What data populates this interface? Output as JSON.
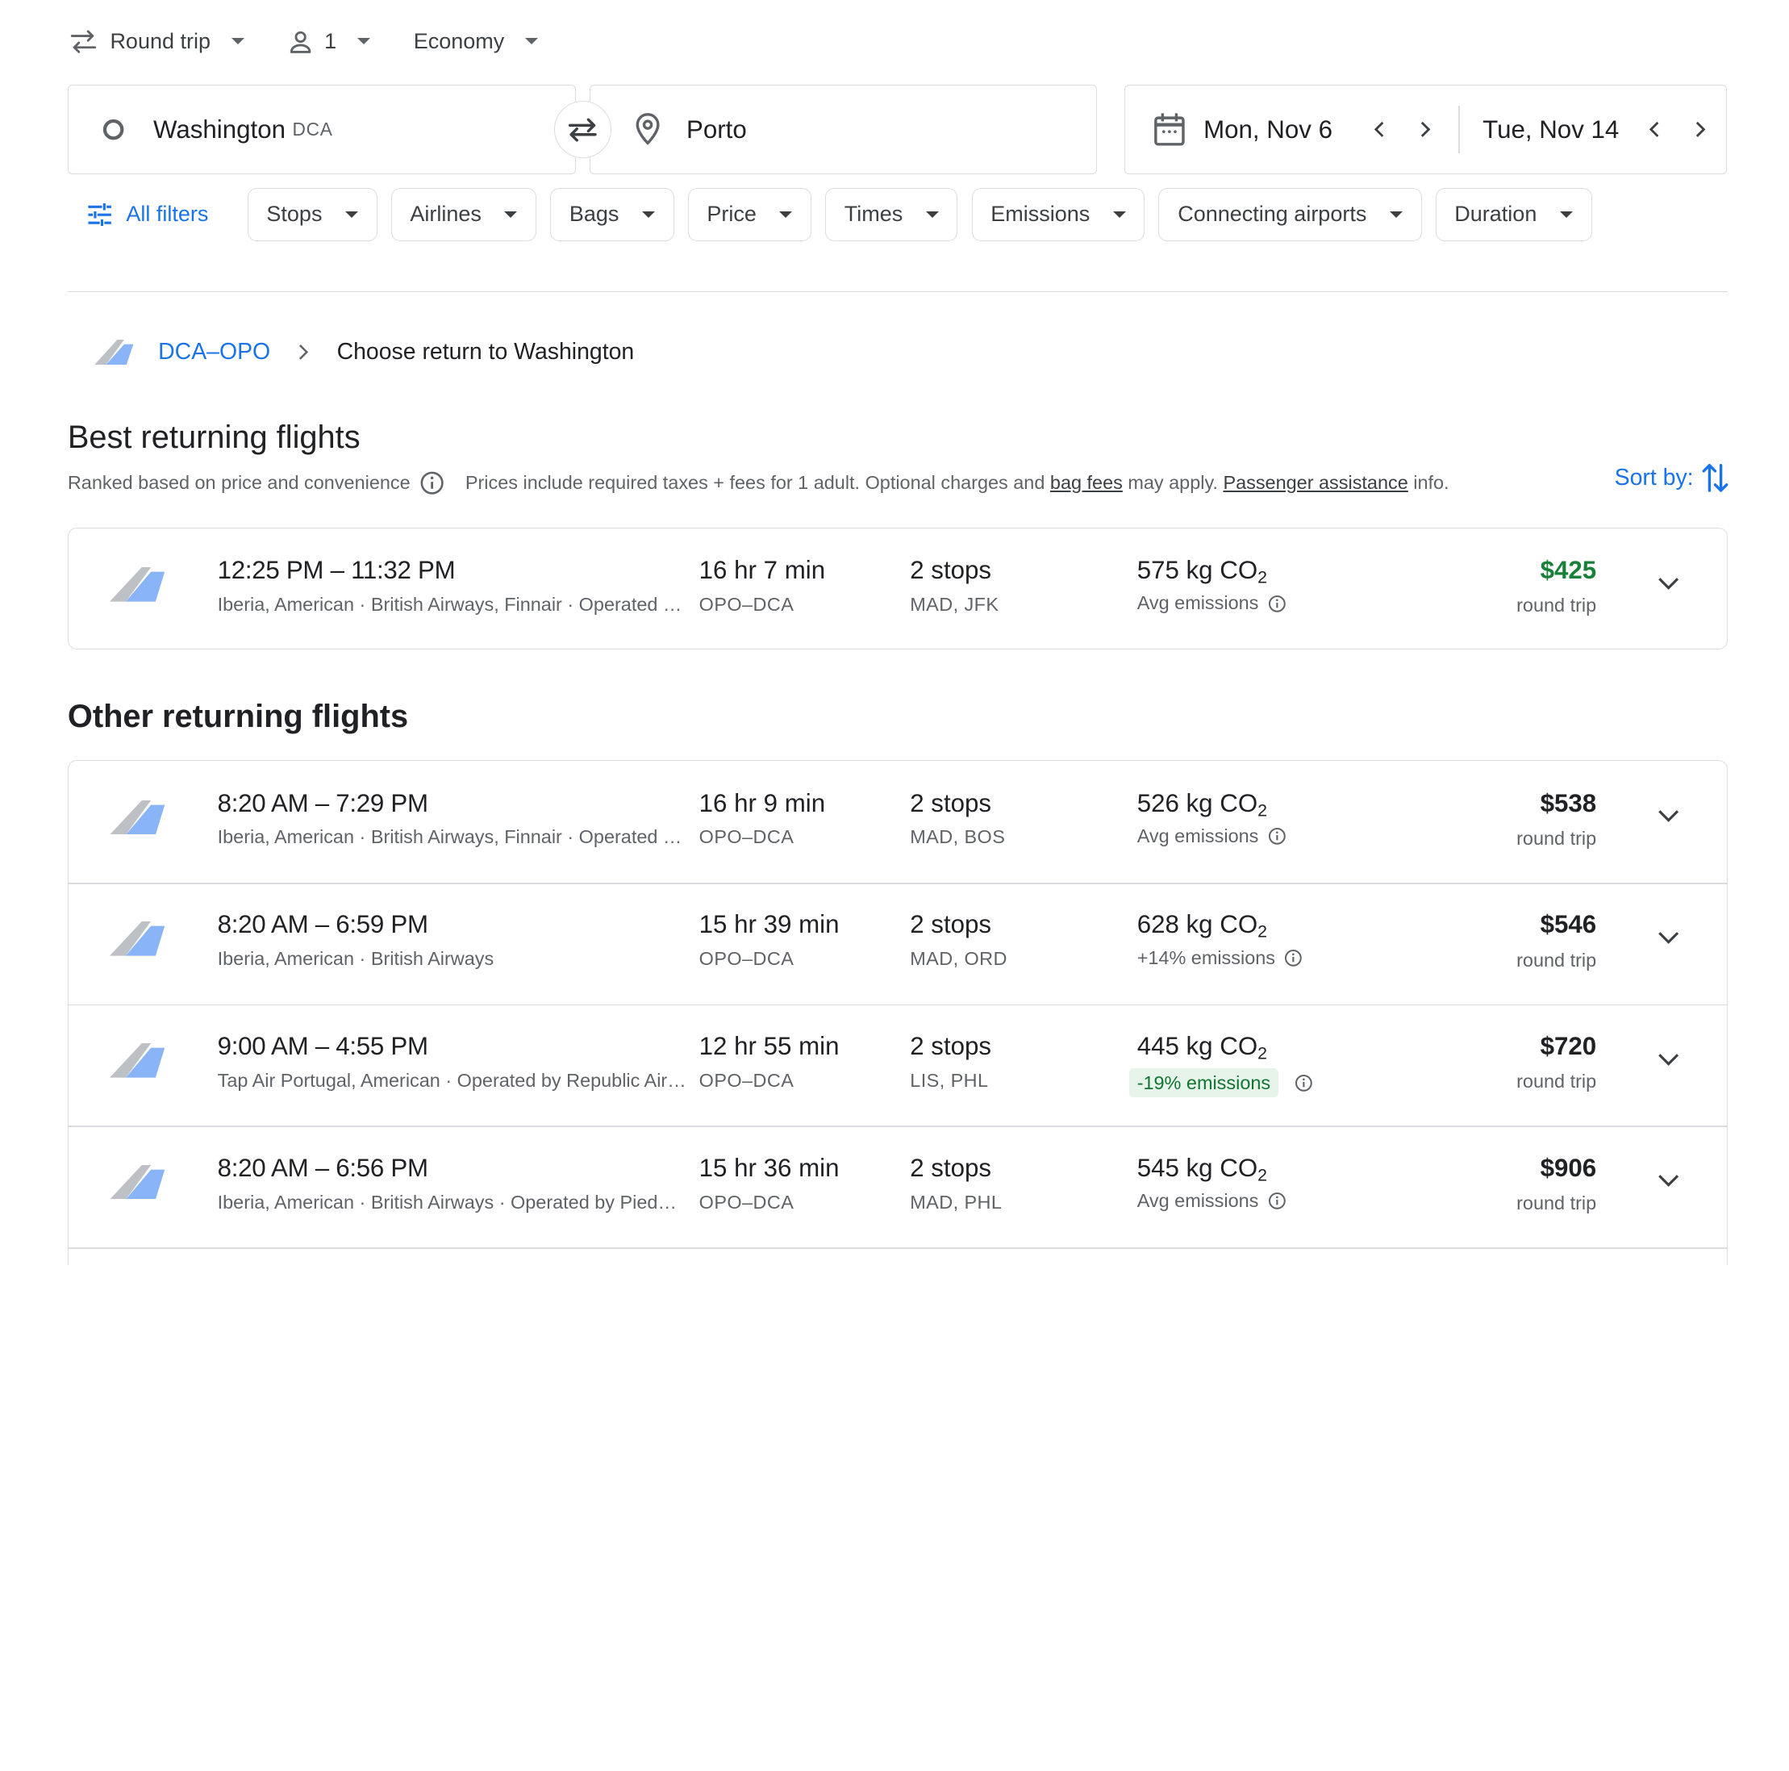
{
  "topbar": {
    "trip_type": "Round trip",
    "passengers": "1",
    "cabin": "Economy"
  },
  "search": {
    "origin_city": "Washington",
    "origin_code": "DCA",
    "destination": "Porto",
    "depart_date": "Mon, Nov 6",
    "return_date": "Tue, Nov 14"
  },
  "filters": {
    "all_filters": "All filters",
    "chips": [
      "Stops",
      "Airlines",
      "Bags",
      "Price",
      "Times",
      "Emissions",
      "Connecting airports",
      "Duration"
    ]
  },
  "breadcrumb": {
    "route_link": "DCA–OPO",
    "current": "Choose return to Washington"
  },
  "best": {
    "heading": "Best returning flights",
    "ranked": "Ranked based on price and convenience",
    "prices_note_1": "Prices include required taxes + fees for 1 adult. Optional charges and",
    "bag_fees": "bag fees",
    "prices_note_2": "may apply.",
    "passenger_assistance": "Passenger assistance",
    "prices_note_3": "info.",
    "sort_by": "Sort by:"
  },
  "other": {
    "heading": "Other returning flights"
  },
  "flights_best": [
    {
      "times": "12:25 PM – 11:32 PM",
      "airlines": "Iberia, American · British Airways, Finnair · Operated by Republic Airways as American Eagle",
      "duration": "16 hr 7 min",
      "route": "OPO–DCA",
      "stops": "2 stops",
      "stop_codes": "MAD, JFK",
      "co2_value": "575 kg CO",
      "co2_sub": "2",
      "emissions": "Avg emissions",
      "price": "$425",
      "price_sub": "round trip"
    }
  ],
  "flights_other": [
    {
      "times": "8:20 AM – 7:29 PM",
      "airlines": "Iberia, American · British Airways, Finnair · Operated by Republic Airways as American Eagle",
      "duration": "16 hr 9 min",
      "route": "OPO–DCA",
      "stops": "2 stops",
      "stop_codes": "MAD, BOS",
      "co2_value": "526 kg CO",
      "co2_sub": "2",
      "emissions": "Avg emissions",
      "price": "$538",
      "price_sub": "round trip"
    },
    {
      "times": "8:20 AM – 6:59 PM",
      "airlines": "Iberia, American · British Airways",
      "duration": "15 hr 39 min",
      "route": "OPO–DCA",
      "stops": "2 stops",
      "stop_codes": "MAD, ORD",
      "co2_value": "628 kg CO",
      "co2_sub": "2",
      "emissions": "+14% emissions",
      "price": "$546",
      "price_sub": "round trip"
    },
    {
      "times": "9:00 AM – 4:55 PM",
      "airlines": "Tap Air Portugal, American · Operated by Republic Airways as American Eagle",
      "duration": "12 hr 55 min",
      "route": "OPO–DCA",
      "stops": "2 stops",
      "stop_codes": "LIS, PHL",
      "co2_value": "445 kg CO",
      "co2_sub": "2",
      "emissions": "-19% emissions",
      "price": "$720",
      "price_sub": "round trip"
    },
    {
      "times": "8:20 AM – 6:56 PM",
      "airlines": "Iberia, American · British Airways · Operated by Piedmont as American Eagle",
      "duration": "15 hr 36 min",
      "route": "OPO–DCA",
      "stops": "2 stops",
      "stop_codes": "MAD, PHL",
      "co2_value": "545 kg CO",
      "co2_sub": "2",
      "emissions": "Avg emissions",
      "price": "$906",
      "price_sub": "round trip"
    }
  ],
  "icons": {
    "swap": "swap-arrows-icon",
    "person": "person-icon",
    "origin": "circle-icon",
    "destination": "location-pin-icon",
    "calendar": "calendar-icon",
    "filters": "tune-icon",
    "sort": "sort-arrows-icon",
    "expand": "chevron-down-icon",
    "info": "info-icon"
  },
  "colors": {
    "accent": "#1a73e8",
    "best_price": "#188038",
    "low_emission_bg": "#e6f4ea",
    "low_emission_text": "#137333",
    "border": "#dadce0"
  }
}
